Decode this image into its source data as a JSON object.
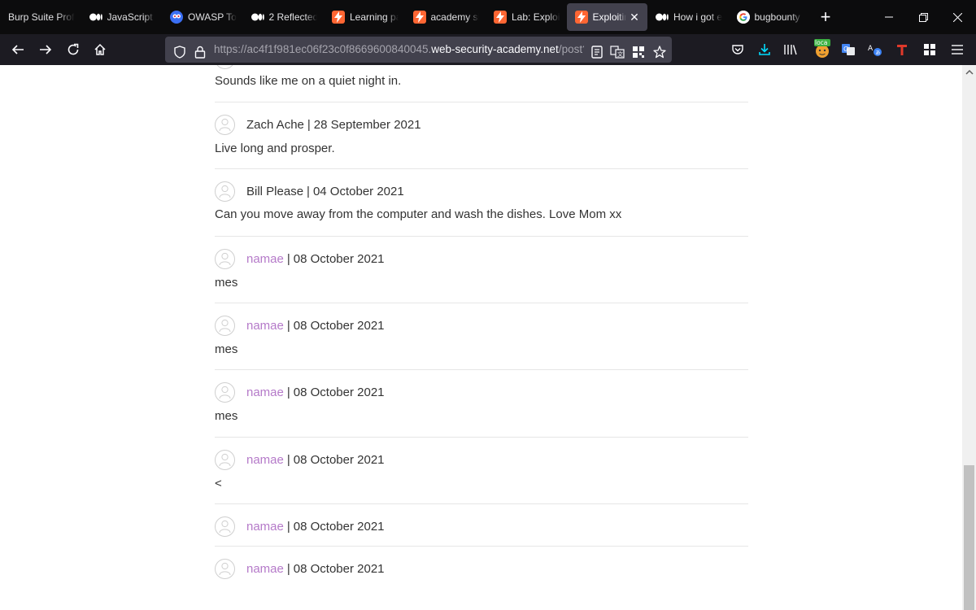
{
  "browser": {
    "tabs": [
      {
        "title": "Burp Suite Profe",
        "favicon": "none"
      },
      {
        "title": "JavaScript a",
        "favicon": "medium-icon"
      },
      {
        "title": "OWASP Top",
        "favicon": "owasp-icon"
      },
      {
        "title": "2 Reflected",
        "favicon": "medium-icon"
      },
      {
        "title": "Learning pa",
        "favicon": "burp-icon"
      },
      {
        "title": "academy sit",
        "favicon": "burp-icon"
      },
      {
        "title": "Lab: Exploit",
        "favicon": "burp-icon"
      },
      {
        "title": "Exploiting",
        "favicon": "burp-icon",
        "active": true
      },
      {
        "title": "How i got e",
        "favicon": "medium-icon"
      },
      {
        "title": "bugbounty",
        "favicon": "google-icon"
      }
    ],
    "url": {
      "prefix": "https://",
      "host_dim": "ac4f1f981ec06f23c0f8669600840045.",
      "host_main": "web-security-academy.net",
      "path": "/post?po"
    },
    "extension_badge": "loca",
    "accent_color": "#ff6633"
  },
  "comments": {
    "partial_first": {
      "body": "Sounds like me on a quiet night in."
    },
    "items": [
      {
        "author": "Zach Ache",
        "date": "28 September 2021",
        "body": "Live long and prosper.",
        "is_link": false
      },
      {
        "author": "Bill Please",
        "date": "04 October 2021",
        "body": "Can you move away from the computer and wash the dishes. Love Mom xx",
        "is_link": false
      },
      {
        "author": "namae",
        "date": "08 October 2021",
        "body": "mes",
        "is_link": true
      },
      {
        "author": "namae",
        "date": "08 October 2021",
        "body": "mes",
        "is_link": true
      },
      {
        "author": "namae",
        "date": "08 October 2021",
        "body": "mes",
        "is_link": true
      },
      {
        "author": "namae",
        "date": "08 October 2021",
        "body": "<",
        "is_link": true
      },
      {
        "author": "namae",
        "date": "08 October 2021",
        "body": "",
        "is_link": true
      },
      {
        "author": "namae",
        "date": "08 October 2021",
        "body": "",
        "is_link": true
      }
    ],
    "separator": "|"
  }
}
